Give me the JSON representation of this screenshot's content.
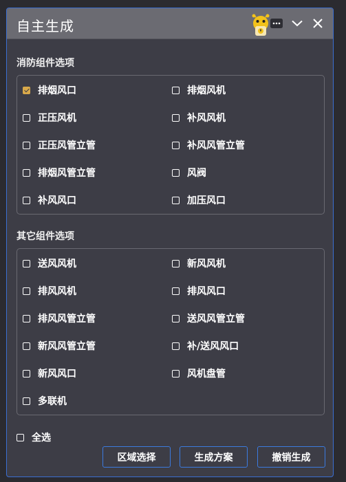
{
  "window": {
    "title": "自主生成",
    "controls": {
      "menu_icon": "ellipsis-icon",
      "collapse_icon": "chevron-down-icon",
      "close_icon": "close-icon"
    }
  },
  "fire_section": {
    "label": "消防组件选项",
    "options": [
      {
        "label": "排烟风口",
        "checked": true
      },
      {
        "label": "排烟风机",
        "checked": false
      },
      {
        "label": "正压风机",
        "checked": false
      },
      {
        "label": "补风风机",
        "checked": false
      },
      {
        "label": "正压风管立管",
        "checked": false
      },
      {
        "label": "补风风管立管",
        "checked": false
      },
      {
        "label": "排烟风管立管",
        "checked": false
      },
      {
        "label": "风阀",
        "checked": false
      },
      {
        "label": "补风风口",
        "checked": false
      },
      {
        "label": "加压风口",
        "checked": false
      }
    ]
  },
  "other_section": {
    "label": "其它组件选项",
    "options": [
      {
        "label": "送风风机",
        "checked": false
      },
      {
        "label": "新风风机",
        "checked": false
      },
      {
        "label": "排风风机",
        "checked": false
      },
      {
        "label": "排风风口",
        "checked": false
      },
      {
        "label": "排风风管立管",
        "checked": false
      },
      {
        "label": "送风风管立管",
        "checked": false
      },
      {
        "label": "新风风管立管",
        "checked": false
      },
      {
        "label": "补/送风风口",
        "checked": false
      },
      {
        "label": "新风风口",
        "checked": false
      },
      {
        "label": "风机盘管",
        "checked": false
      },
      {
        "label": "多联机",
        "checked": false
      }
    ]
  },
  "select_all": {
    "label": "全选",
    "checked": false
  },
  "buttons": {
    "region_select": "区域选择",
    "generate_plan": "生成方案",
    "undo_generate": "撤销生成"
  },
  "colors": {
    "accent": "#3b7be0",
    "checked": "#d9a94a",
    "background": "#3d3d46",
    "titlebar": "#6b6b72"
  }
}
